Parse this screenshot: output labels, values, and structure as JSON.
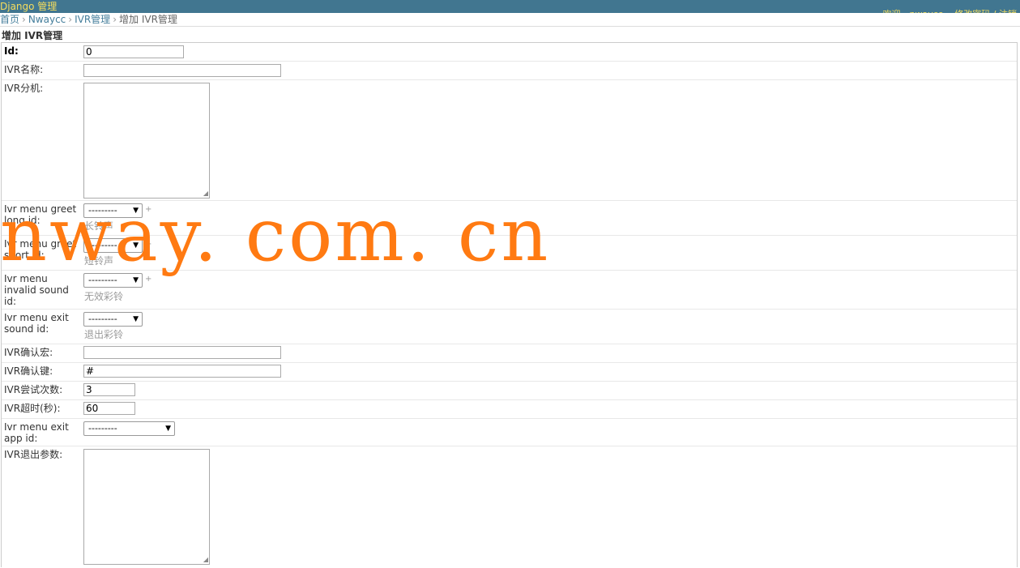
{
  "header": {
    "brand": "Django 管理",
    "user_tools": "欢迎，nwaycc。 修改密码 / 注销"
  },
  "breadcrumbs": {
    "home": "首页",
    "app": "Nwaycc",
    "model": "IVR管理",
    "current": "增加 IVR管理"
  },
  "page_title": "增加 IVR管理",
  "form": {
    "id": {
      "label": "Id:",
      "value": "0"
    },
    "ivr_name": {
      "label": "IVR名称:",
      "value": ""
    },
    "ivr_extension": {
      "label": "IVR分机:",
      "value": ""
    },
    "greet_long": {
      "label": "Ivr menu greet long id:",
      "selected": "---------",
      "help": "长铃声"
    },
    "greet_short": {
      "label": "Ivr menu greet short id:",
      "selected": "---------",
      "help": "短铃声"
    },
    "invalid_sound": {
      "label": "Ivr menu invalid sound id:",
      "selected": "---------",
      "help": "无效彩铃"
    },
    "exit_sound": {
      "label": "Ivr menu exit sound id:",
      "selected": "---------",
      "help": "退出彩铃"
    },
    "confirm_macro": {
      "label": "IVR确认宏:",
      "value": ""
    },
    "confirm_key": {
      "label": "IVR确认键:",
      "value": "#"
    },
    "tries": {
      "label": "IVR尝试次数:",
      "value": "3"
    },
    "timeout": {
      "label": "IVR超时(秒):",
      "value": "60"
    },
    "exit_app": {
      "label": "Ivr menu exit app id:",
      "selected": "---------"
    },
    "exit_param": {
      "label": "IVR退出参数:",
      "value": ""
    }
  },
  "watermark": "nway. com. cn",
  "colors": {
    "header_bg": "#417690",
    "header_text": "#f5dd5d",
    "link": "#447e9b",
    "watermark": "#ff7a12"
  },
  "icons": {
    "select_arrow": "chevron-down-icon",
    "resize": "resize-grip-icon",
    "add": "add-related-icon"
  }
}
